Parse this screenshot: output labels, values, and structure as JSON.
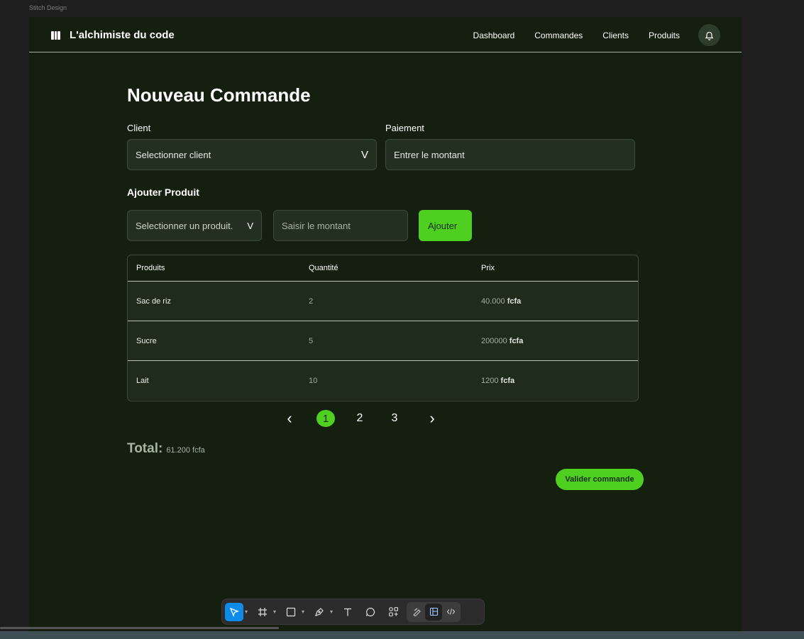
{
  "canvas": {
    "label": "Stitch Design"
  },
  "header": {
    "brand": "L'alchimiste du code",
    "nav": [
      "Dashboard",
      "Commandes",
      "Clients",
      "Produits"
    ]
  },
  "page": {
    "title": "Nouveau Commande"
  },
  "form": {
    "client_label": "Client",
    "client_select": "Selectionner client",
    "payment_label": "Paiement",
    "payment_placeholder": "Entrer le montant",
    "add_section": "Ajouter Produit",
    "product_select": "Selectionner un produit.",
    "amount_placeholder": "Saisir le montant",
    "add_button": "Ajouter",
    "select_chevron": "V"
  },
  "table": {
    "headers": [
      "Produits",
      "Quantité",
      "Prix"
    ],
    "rows": [
      {
        "product": "Sac de riz",
        "qty": "2",
        "price": "40.000",
        "unit": "fcfa"
      },
      {
        "product": "Sucre",
        "qty": "5",
        "price": "200000",
        "unit": "fcfa"
      },
      {
        "product": "Lait",
        "qty": "10",
        "price": "1200",
        "unit": "fcfa"
      }
    ]
  },
  "pagination": {
    "prev": "‹",
    "pages": [
      "1",
      "2",
      "3"
    ],
    "next": "›",
    "active": "1"
  },
  "summary": {
    "total_label": "Total:",
    "total_value": "61.200 fcfa"
  },
  "actions": {
    "validate": "Valider commande"
  },
  "colors": {
    "accent": "#4fd021",
    "background": "#141f10",
    "field": "#233021"
  },
  "toolbar": {
    "icons": [
      "move-tool-icon",
      "frame-tool-icon",
      "rectangle-tool-icon",
      "pen-tool-icon",
      "text-tool-icon",
      "comment-tool-icon",
      "components-icon",
      "draw-mode-icon",
      "design-mode-icon",
      "dev-mode-icon"
    ]
  }
}
